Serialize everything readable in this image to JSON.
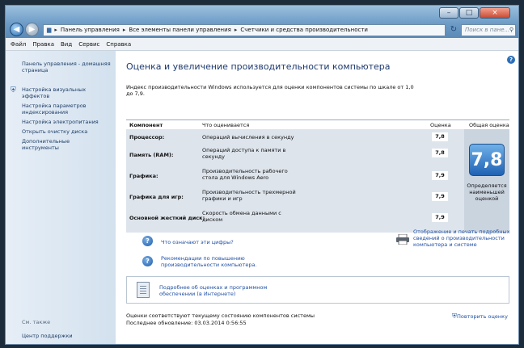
{
  "titlebar": {
    "minimize": "–",
    "maximize": "□",
    "close": "×"
  },
  "address": {
    "crumbs": [
      "Панель управления",
      "Все элементы панели управления",
      "Счетчики и средства производительности"
    ],
    "search_placeholder": "Поиск в пане..."
  },
  "menu": [
    "Файл",
    "Правка",
    "Вид",
    "Сервис",
    "Справка"
  ],
  "sidebar": {
    "home": "Панель управления - домашняя страница",
    "links": [
      "Настройка визуальных эффектов",
      "Настройка параметров индексирования",
      "Настройка электропитания",
      "Открыть очистку диска",
      "Дополнительные инструменты"
    ],
    "see_also": "См. также",
    "support": "Центр поддержки"
  },
  "main": {
    "title": "Оценка и увеличение производительности компьютера",
    "description": "Индекс производительности Windows используется для оценки компонентов системы по шкале от 1,0 до 7,9.",
    "headers": {
      "component": "Компонент",
      "what": "Что оценивается",
      "score": "Оценка",
      "base": "Общая оценка"
    },
    "rows": [
      {
        "component": "Процессор:",
        "what": "Операций вычисления в секунду",
        "score": "7,8"
      },
      {
        "component": "Память (RAM):",
        "what": "Операций доступа к памяти в секунду",
        "score": "7,8"
      },
      {
        "component": "Графика:",
        "what": "Производительность рабочего стола для Windows Aero",
        "score": "7,9"
      },
      {
        "component": "Графика для игр:",
        "what": "Производительность трехмерной графики и игр",
        "score": "7,9"
      },
      {
        "component": "Основной жесткий диск:",
        "what": "Скорость обмена данными с диском",
        "score": "7,9"
      }
    ],
    "base_score": "7,8",
    "base_caption": "Определяется наименьшей оценкой",
    "link_numbers": "Что означают эти цифры?",
    "link_recommend": "Рекомендации по повышению производительности компьютера.",
    "link_print": "Отображение и печать подробных сведений о производительности компьютера и системе",
    "link_details": "Подробнее об оценках и программном обеспечении (в Интернете)",
    "status": "Оценки соответствуют текущему состоянию компонентов системы",
    "last_update": "Последнее обновление: 03.03.2014 0:56:55",
    "repeat": "Повторить оценку"
  }
}
